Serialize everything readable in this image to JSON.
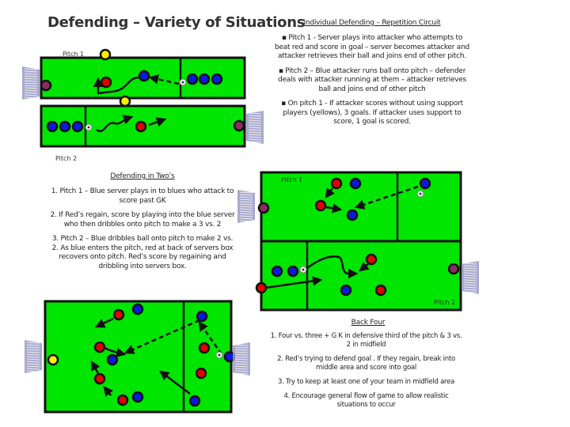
{
  "colors": {
    "pitch_green": "#00e600",
    "line": "#111111",
    "red_player": "#e00000",
    "blue_player": "#0a1adc",
    "yellow_player": "#ffee00",
    "gk_player": "#8a2d60",
    "goal": "#9a9ac8"
  },
  "page": {
    "title": "Defending – Variety of Situations"
  },
  "circuit": {
    "heading": "Individual Defending – Repetition Circuit",
    "bullets": [
      "▪  Pitch 1 - Server plays into attacker who attempts to beat red and score in goal – server becomes attacker and attacker retrieves their ball and joins end of other pitch.",
      "▪  Pitch 2 – Blue attacker runs ball onto pitch – defender deals with attacker running at them – attacker retrieves ball and joins end of other pitch",
      "▪  On pitch 1 - If attacker scores without using support players (yellows), 3 goals. If attacker uses support to score, 1 goal is scored."
    ],
    "pitch1_label": "Pitch 1",
    "pitch2_label": "Pitch 2"
  },
  "twos": {
    "heading": "Defending in Two’s",
    "items": [
      "1. Pitch 1 – Blue server plays in to blues who attack to score past GK",
      "2. If Red’s regain,  score by playing into the blue server who then dribbles onto pitch to make a 3 vs. 2",
      "3. Pitch 2 – Blue dribbles ball onto pitch to make 2 vs. 2. As blue enters the pitch, red at back of servers box recovers onto pitch. Red’s score by regaining and dribbling into servers box."
    ],
    "pitch1_label": "Pitch 1",
    "pitch2_label": "Pitch 2"
  },
  "backfour": {
    "heading": "Back Four",
    "items": [
      "1.  Four vs. three + G K in defensive third of the pitch & 3 vs. 2 in midfield",
      "2.  Red’s trying to defend goal . If they regain, break into middle area and score into goal",
      "3.  Try to keep at least one of your team in midfield area",
      "4.  Encourage general flow of game to allow realistic situations to occur"
    ]
  }
}
